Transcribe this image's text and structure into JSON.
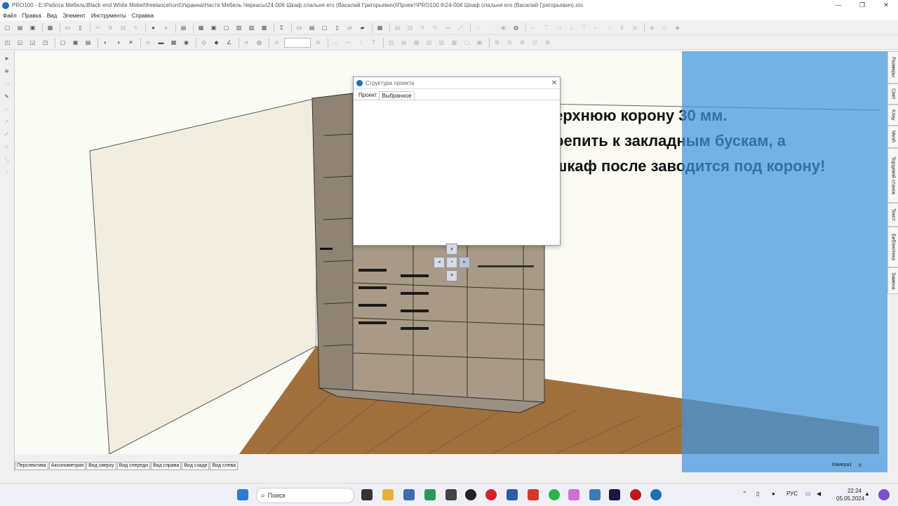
{
  "window": {
    "title": "PRO100 - E:\\Работа Мебель\\Black end White Mebel\\freelancehunt\\Украина\\Настя Мебель Черкасы\\24-006 Шкаф спальня его (Василий Григорьевич)\\Проект\\PRO100 6\\24-006 Шкаф спальня его (Василий Григорьевич).sto",
    "minimize": "—",
    "maximize": "❐",
    "close": "✕"
  },
  "menu": [
    "Файл",
    "Правка",
    "Вид",
    "Элемент",
    "Инструменты",
    "Справка"
  ],
  "overlay_text": [
    "ерхнюю корону 30 мм.",
    "репить к закладным бускам, а",
    "шкаф после заводится под корону!"
  ],
  "dialog": {
    "title": "Структура проекта",
    "close": "✕",
    "tabs": [
      "Проект",
      "Выбранное"
    ]
  },
  "right_tabs": [
    "Размеры",
    "Свет",
    "Клау",
    "Mesh",
    "Торцевой станок",
    "Текст",
    "Библиотека",
    "Замена"
  ],
  "view_tabs": [
    "Перспектива",
    "Аксонометрия",
    "Вид сверху",
    "Вид спереди",
    "Вид справа",
    "Вид сзади",
    "Вид слева"
  ],
  "camera": {
    "label": "Камера1",
    "close": "✕"
  },
  "taskbar": {
    "search_placeholder": "Поиск",
    "lang": "РУС",
    "time": "22:24",
    "date": "05.05.2024"
  },
  "colors": {
    "accent": "#1f6fb8",
    "overlay_blue": "#4096e1",
    "floor": "#a0703e",
    "cabinet": "#a89a86"
  }
}
